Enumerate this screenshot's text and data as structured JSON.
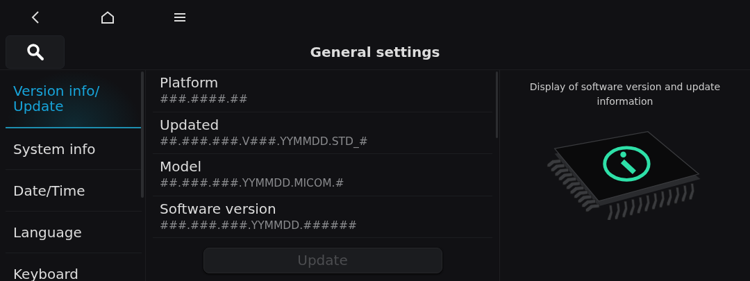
{
  "nav": {
    "buttons": [
      {
        "kind": "back"
      },
      {
        "kind": "home"
      },
      {
        "kind": "menu"
      }
    ]
  },
  "header": {
    "title": "General settings"
  },
  "sidebar": {
    "items": [
      {
        "label": "Version info/\nUpdate",
        "selected": true
      },
      {
        "label": "System info",
        "selected": false
      },
      {
        "label": "Date/Time",
        "selected": false
      },
      {
        "label": "Language",
        "selected": false
      },
      {
        "label": "Keyboard",
        "selected": false
      }
    ]
  },
  "info": {
    "rows": [
      {
        "label": "Platform",
        "value": "###.####.##"
      },
      {
        "label": "Updated",
        "value": "##.###.###.V###.YYMMDD.STD_#"
      },
      {
        "label": "Model",
        "value": "##.###.###.YYMMDD.MICOM.#"
      },
      {
        "label": "Software version",
        "value": "###.###.###.YYMMDD.######"
      }
    ],
    "update_button": {
      "label": "Update",
      "disabled": true
    }
  },
  "help": {
    "text": "Display of software version and update information"
  }
}
